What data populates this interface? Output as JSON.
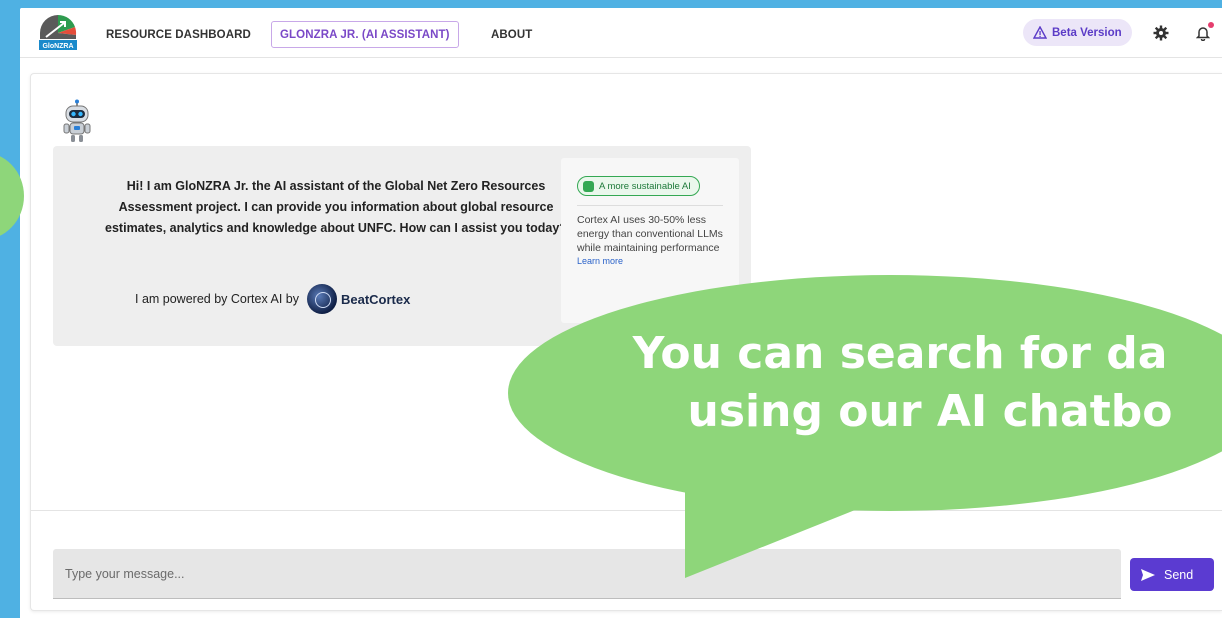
{
  "nav": {
    "logo_text": "GloNZRA",
    "tabs": [
      {
        "label": "RESOURCE DASHBOARD",
        "active": false
      },
      {
        "label": "GLONZRA JR. (AI ASSISTANT)",
        "active": true
      },
      {
        "label": "ABOUT",
        "active": false
      }
    ],
    "beta_label": "Beta Version",
    "icons": [
      "warning-icon",
      "gear-icon",
      "bell-icon"
    ]
  },
  "chat": {
    "greeting": "Hi! I am GloNZRA Jr. the AI assistant of the Global Net Zero Resources Assessment project. I can provide you information about global resource estimates, analytics and knowledge about UNFC. How can I assist you today?",
    "powered_by": "I am powered by Cortex AI by",
    "powered_brand": "BeatCortex",
    "side_card": {
      "badge": "A more sustainable AI",
      "text": "Cortex AI uses 30-50% less energy than conventional LLMs while maintaining performance",
      "link": "Learn more"
    }
  },
  "input": {
    "placeholder": "Type your message...",
    "send_label": "Send"
  },
  "callout": {
    "line1": "You can search for da",
    "line2": "using our AI chatbo"
  },
  "colors": {
    "background": "#4fb1e3",
    "accent": "#5b3bd1",
    "callout_green": "#8ed67a",
    "sustainable_green": "#34a853"
  }
}
